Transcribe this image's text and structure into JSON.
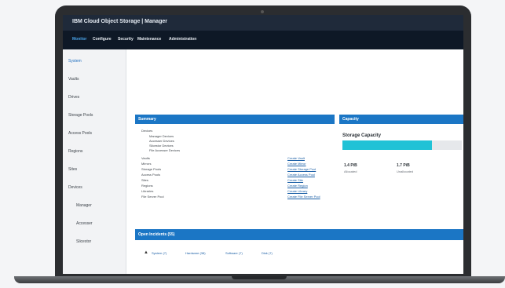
{
  "app": {
    "title": "IBM Cloud Object Storage | Manager"
  },
  "nav": {
    "tabs": [
      "Monitor",
      "Configure",
      "Security",
      "Maintenance",
      "Administration"
    ]
  },
  "sidebar": {
    "items": [
      "System",
      "Vaults",
      "Drives",
      "Storage Pools",
      "Access Pools",
      "Regions",
      "Sites",
      "Devices",
      "Manager",
      "Accesser",
      "Slicestor"
    ]
  },
  "summary": {
    "title": "Summary",
    "items": [
      "Devices",
      "Manager Devices",
      "Accesser Devices",
      "Slicestor Devices",
      "File Accesser Devices",
      "Vaults",
      "Mirrors",
      "Storage Pools",
      "Access Pools",
      "Sites",
      "Regions",
      "Libraries",
      "File Server Pool"
    ],
    "links": [
      "Create Vault",
      "Create Mirror",
      "Create Storage Pool",
      "Create Access Pool",
      "Create Site",
      "Create Region",
      "Create Library",
      "Create File Server Pool"
    ]
  },
  "capacity": {
    "title": "Capacity",
    "subtitle": "Storage Capacity",
    "used_fraction": 0.75,
    "allocated_value": "1.4 PiB",
    "allocated_label": "Allocated",
    "unallocated_value": "1.7 PiB",
    "unallocated_label": "Unallocated"
  },
  "incidents": {
    "title": "Open Incidents (55)",
    "filters": [
      "System (7)",
      "Hardware (38)",
      "Software (7)",
      "Disk (7)"
    ]
  },
  "colors": {
    "accent": "#1b76c5",
    "nav_bg": "#0e1826",
    "capacity_fill": "#20c2d6"
  }
}
